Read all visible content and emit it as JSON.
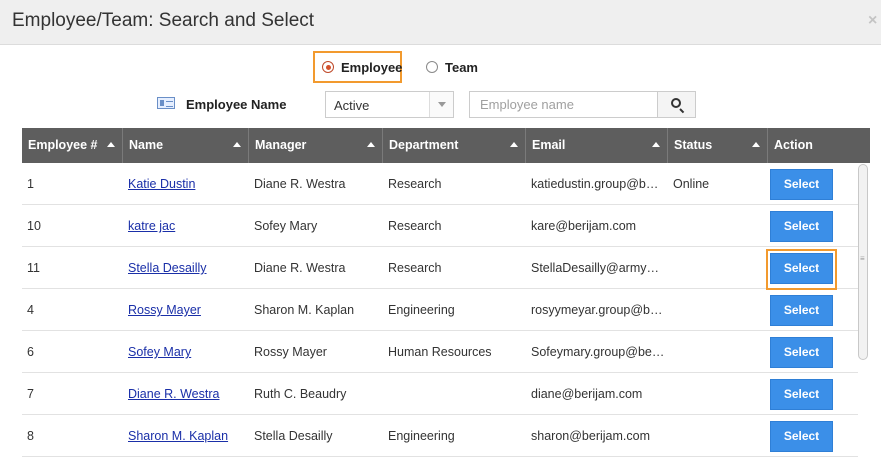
{
  "dialog": {
    "title": "Employee/Team: Search and Select",
    "close_label": "×"
  },
  "mode": {
    "options": [
      {
        "label": "Employee",
        "checked": true
      },
      {
        "label": "Team",
        "checked": false
      }
    ]
  },
  "filter": {
    "label": "Employee Name",
    "status_select": "Active",
    "search_placeholder": "Employee name"
  },
  "table": {
    "columns": [
      "Employee #",
      "Name",
      "Manager",
      "Department",
      "Email",
      "Status",
      "Action"
    ],
    "rows": [
      {
        "num": "1",
        "name": "Katie Dustin",
        "manager": "Diane R. Westra",
        "department": "Research",
        "email": "katiedustin.group@b…",
        "status": "Online",
        "action": "Select"
      },
      {
        "num": "10",
        "name": "katre jac",
        "manager": "Sofey Mary",
        "department": "Research",
        "email": "kare@berijam.com",
        "status": "",
        "action": "Select"
      },
      {
        "num": "11",
        "name": "Stella Desailly",
        "manager": "Diane R. Westra",
        "department": "Research",
        "email": "StellaDesailly@army…",
        "status": "",
        "action": "Select"
      },
      {
        "num": "4",
        "name": "Rossy Mayer",
        "manager": "Sharon M. Kaplan",
        "department": "Engineering",
        "email": "rosyymeyar.group@b…",
        "status": "",
        "action": "Select"
      },
      {
        "num": "6",
        "name": "Sofey Mary",
        "manager": "Rossy Mayer",
        "department": "Human Resources",
        "email": "Sofeymary.group@be…",
        "status": "",
        "action": "Select"
      },
      {
        "num": "7",
        "name": "Diane R. Westra",
        "manager": "Ruth C. Beaudry",
        "department": "",
        "email": "diane@berijam.com",
        "status": "",
        "action": "Select"
      },
      {
        "num": "8",
        "name": "Sharon M. Kaplan",
        "manager": "Stella Desailly",
        "department": "Engineering",
        "email": "sharon@berijam.com",
        "status": "",
        "action": "Select"
      }
    ],
    "highlighted_row": 2
  },
  "colors": {
    "header_bg": "#5e5e5e",
    "button_blue": "#3b8fe8",
    "highlight_orange": "#f29a2e",
    "link_blue": "#1a2fa8"
  }
}
